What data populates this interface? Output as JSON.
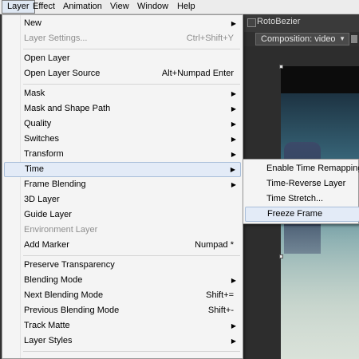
{
  "menubar": {
    "items": [
      "Layer",
      "Effect",
      "Animation",
      "View",
      "Window",
      "Help"
    ],
    "active": "Layer"
  },
  "toolbar": {
    "rotobezier_label": "RotoBezier"
  },
  "composition_tab": {
    "label": "Composition: video"
  },
  "layer_menu": {
    "items": [
      {
        "label": "New",
        "shortcut": "",
        "submenu": true,
        "disabled": false
      },
      {
        "label": "Layer Settings...",
        "shortcut": "Ctrl+Shift+Y",
        "submenu": false,
        "disabled": true
      },
      {
        "label": "Open Layer",
        "shortcut": "",
        "submenu": false,
        "disabled": false
      },
      {
        "label": "Open Layer Source",
        "shortcut": "Alt+Numpad Enter",
        "submenu": false,
        "disabled": false
      },
      {
        "label": "Mask",
        "shortcut": "",
        "submenu": true,
        "disabled": false
      },
      {
        "label": "Mask and Shape Path",
        "shortcut": "",
        "submenu": true,
        "disabled": false
      },
      {
        "label": "Quality",
        "shortcut": "",
        "submenu": true,
        "disabled": false
      },
      {
        "label": "Switches",
        "shortcut": "",
        "submenu": true,
        "disabled": false
      },
      {
        "label": "Transform",
        "shortcut": "",
        "submenu": true,
        "disabled": false
      },
      {
        "label": "Time",
        "shortcut": "",
        "submenu": true,
        "disabled": false
      },
      {
        "label": "Frame Blending",
        "shortcut": "",
        "submenu": true,
        "disabled": false
      },
      {
        "label": "3D Layer",
        "shortcut": "",
        "submenu": false,
        "disabled": false
      },
      {
        "label": "Guide Layer",
        "shortcut": "",
        "submenu": false,
        "disabled": false
      },
      {
        "label": "Environment Layer",
        "shortcut": "",
        "submenu": false,
        "disabled": true
      },
      {
        "label": "Add Marker",
        "shortcut": "Numpad *",
        "submenu": false,
        "disabled": false
      },
      {
        "label": "Preserve Transparency",
        "shortcut": "",
        "submenu": false,
        "disabled": false
      },
      {
        "label": "Blending Mode",
        "shortcut": "",
        "submenu": true,
        "disabled": false
      },
      {
        "label": "Next Blending Mode",
        "shortcut": "Shift+=",
        "submenu": false,
        "disabled": false
      },
      {
        "label": "Previous Blending Mode",
        "shortcut": "Shift+-",
        "submenu": false,
        "disabled": false
      },
      {
        "label": "Track Matte",
        "shortcut": "",
        "submenu": true,
        "disabled": false
      },
      {
        "label": "Layer Styles",
        "shortcut": "",
        "submenu": true,
        "disabled": false
      }
    ],
    "highlighted": "Time"
  },
  "time_submenu": {
    "items": [
      "Enable Time Remapping",
      "Time-Reverse Layer",
      "Time Stretch...",
      "Freeze Frame"
    ],
    "highlighted": "Freeze Frame"
  },
  "colors": {
    "highlight_bg": "#e3ebf7",
    "highlight_border": "#a9bed9",
    "disabled_text": "#8e8e8e"
  }
}
